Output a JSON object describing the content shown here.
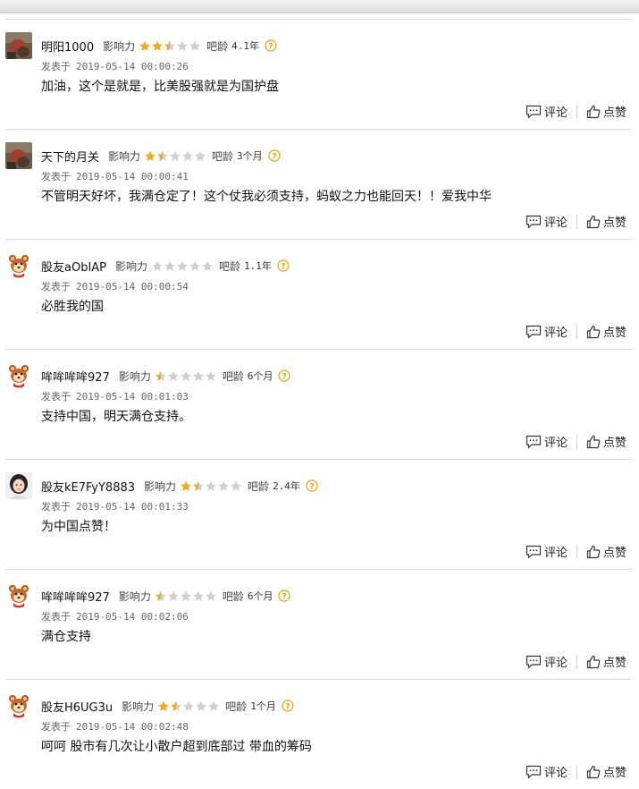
{
  "labels": {
    "influence": "影响力",
    "bar_age": "吧龄",
    "posted_prefix": "发表于",
    "reply": "评论",
    "like": "点赞"
  },
  "colors": {
    "star_filled": "#f0a81c",
    "star_empty": "#cfcfcf",
    "help_icon": "#e0a400"
  },
  "posts": [
    {
      "avatar": "photo-avatar-icon",
      "username": "明阳1000",
      "influence_stars": 2.5,
      "bar_age": "4.1年",
      "time": "2019-05-14 00:00:26",
      "content": "加油，这个是就是，比美股强就是为国护盘"
    },
    {
      "avatar": "photo-avatar-icon",
      "username": "天下的月关",
      "influence_stars": 1.5,
      "bar_age": "3个月",
      "time": "2019-05-14 00:00:41",
      "content": "不管明天好坏，我满仓定了！这个仗我必须支持，蚂蚁之力也能回天！！爱我中华"
    },
    {
      "avatar": "mascot-avatar-icon",
      "username": "股友aObIAP",
      "influence_stars": 0,
      "bar_age": "1.1年",
      "time": "2019-05-14 00:00:54",
      "content": "必胜我的国"
    },
    {
      "avatar": "mascot-avatar-icon",
      "username": "哞哞哞哞927",
      "influence_stars": 0.5,
      "bar_age": "6个月",
      "time": "2019-05-14 00:01:03",
      "content": "支持中国，明天满仓支持。"
    },
    {
      "avatar": "girl-avatar-icon",
      "username": "股友kE7FyY8883",
      "influence_stars": 1.5,
      "bar_age": "2.4年",
      "time": "2019-05-14 00:01:33",
      "content": "为中国点赞！"
    },
    {
      "avatar": "mascot-avatar-icon",
      "username": "哞哞哞哞927",
      "influence_stars": 0.5,
      "bar_age": "6个月",
      "time": "2019-05-14 00:02:06",
      "content": "满仓支持"
    },
    {
      "avatar": "mascot-avatar-icon",
      "username": "股友H6UG3u",
      "influence_stars": 1.5,
      "bar_age": "1个月",
      "time": "2019-05-14 00:02:48",
      "content": "呵呵 股市有几次让小散户超到底部过 带血的筹码"
    }
  ]
}
